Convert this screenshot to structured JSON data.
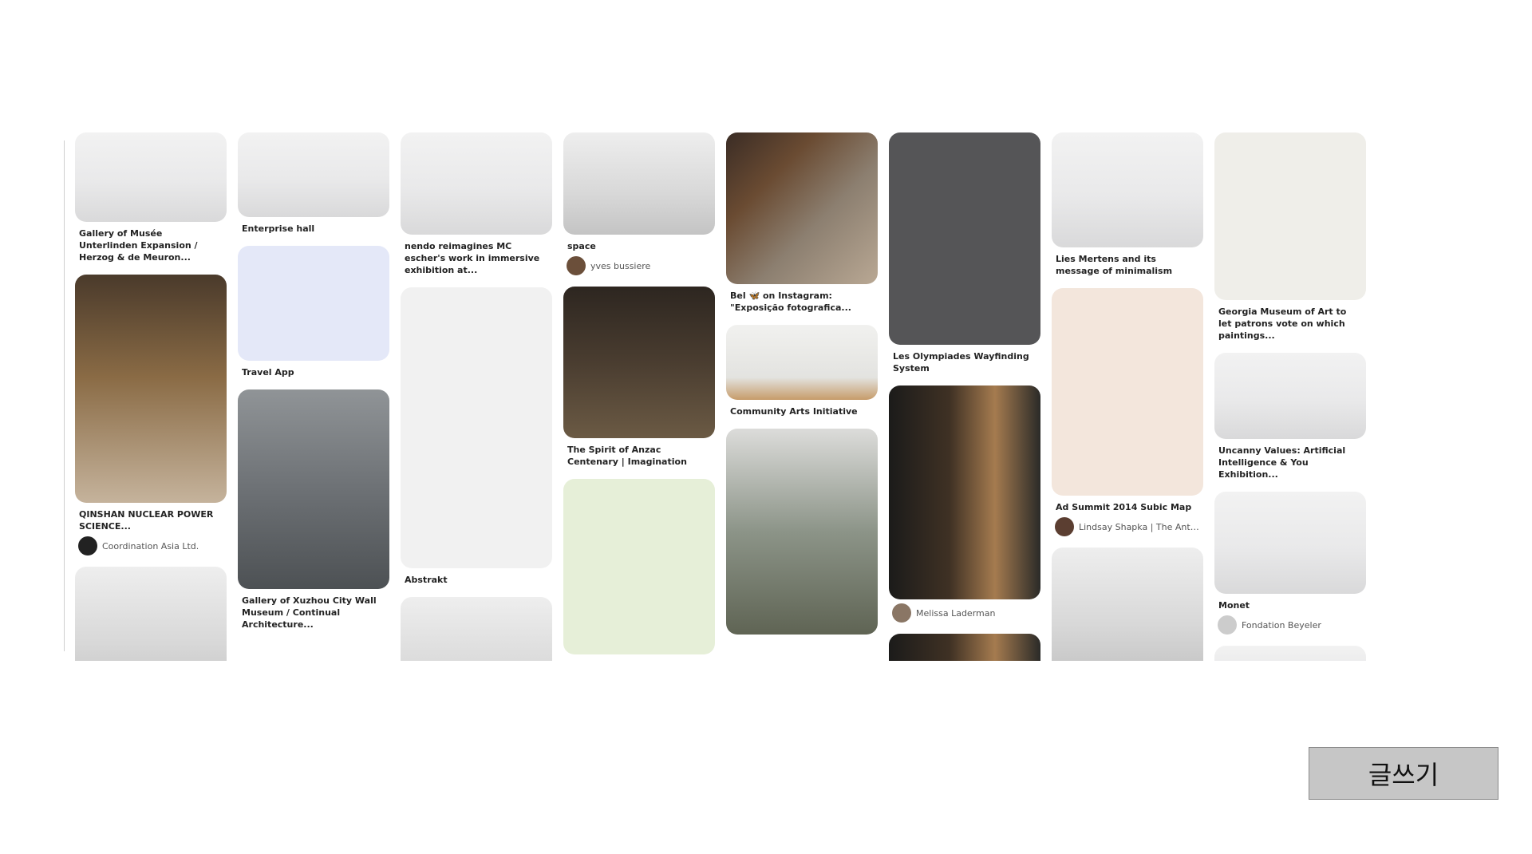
{
  "columns": [
    [
      {
        "title": "Gallery of Musée Unterlinden Expansion / Herzog & de Meuron...",
        "author": "",
        "style": "img-gallery-white",
        "h": 112
      },
      {
        "title": "QINSHAN NUCLEAR POWER SCIENCE...",
        "author": "Coordination Asia Ltd.",
        "style": "img-wood",
        "h": 286
      },
      {
        "title": "",
        "author": "",
        "style": "img-gallery-grey",
        "h": 160
      }
    ],
    [
      {
        "title": "Enterprise hall",
        "author": "",
        "style": "img-gallery-white",
        "h": 106
      },
      {
        "title": "Travel App",
        "author": "",
        "style": "img-app",
        "h": 144
      },
      {
        "title": "Gallery of Xuzhou City Wall Museum / Continual Architecture...",
        "author": "",
        "style": "img-concrete",
        "h": 250
      }
    ],
    [
      {
        "title": "nendo reimagines MC escher's work in immersive exhibition at...",
        "author": "",
        "style": "img-gallery-white",
        "h": 128
      },
      {
        "title": "Abstrakt",
        "author": "",
        "style": "img-abstract",
        "h": 352
      },
      {
        "title": "",
        "author": "",
        "style": "img-gallery-grey",
        "h": 160
      }
    ],
    [
      {
        "title": "space",
        "author": "yves bussiere",
        "style": "img-gallery-grey",
        "h": 128
      },
      {
        "title": "The Spirit of Anzac Centenary | Imagination",
        "author": "",
        "style": "img-dark-frames",
        "h": 190
      },
      {
        "title": "",
        "author": "",
        "style": "img-sql",
        "h": 220
      }
    ],
    [
      {
        "title": "Bel 🦋 on Instagram: \"Exposição fotografica...",
        "author": "",
        "style": "img-color-wall",
        "h": 190
      },
      {
        "title": "Community Arts Initiative",
        "author": "",
        "style": "img-arts",
        "h": 94
      },
      {
        "title": "",
        "author": "",
        "style": "img-glass",
        "h": 258
      }
    ],
    [
      {
        "title": "Les Olympiades Wayfinding System",
        "author": "",
        "style": "img-map-dark",
        "h": 266
      },
      {
        "title": "",
        "author": "Melissa Laderman",
        "style": "img-corridor",
        "h": 268
      },
      {
        "title": "",
        "author": "",
        "style": "img-corridor",
        "h": 80
      }
    ],
    [
      {
        "title": "Lies Mertens and its message of minimalism",
        "author": "",
        "style": "img-gallery-white",
        "h": 144
      },
      {
        "title": "Ad Summit 2014 Subic Map",
        "author": "Lindsay Shapka | The Anthro...",
        "style": "img-map-light",
        "h": 260
      },
      {
        "title": "",
        "author": "",
        "style": "img-gallery-grey",
        "h": 160
      }
    ],
    [
      {
        "title": "Georgia Museum of Art to let patrons vote on which paintings...",
        "author": "",
        "style": "img-poster",
        "h": 210
      },
      {
        "title": "Uncanny Values: Artificial Intelligence & You Exhibition...",
        "author": "",
        "style": "img-gallery-white",
        "h": 108
      },
      {
        "title": "Monet",
        "author": "Fondation Beyeler",
        "style": "img-gallery-white",
        "h": 128
      },
      {
        "title": "",
        "author": "",
        "style": "img-gallery-white",
        "h": 60
      }
    ]
  ],
  "write_button_label": "글쓰기",
  "colors": {
    "button_bg": "#c6c6c6",
    "button_border": "#8a8a8a",
    "title_text": "#222222",
    "author_text": "#555555"
  }
}
